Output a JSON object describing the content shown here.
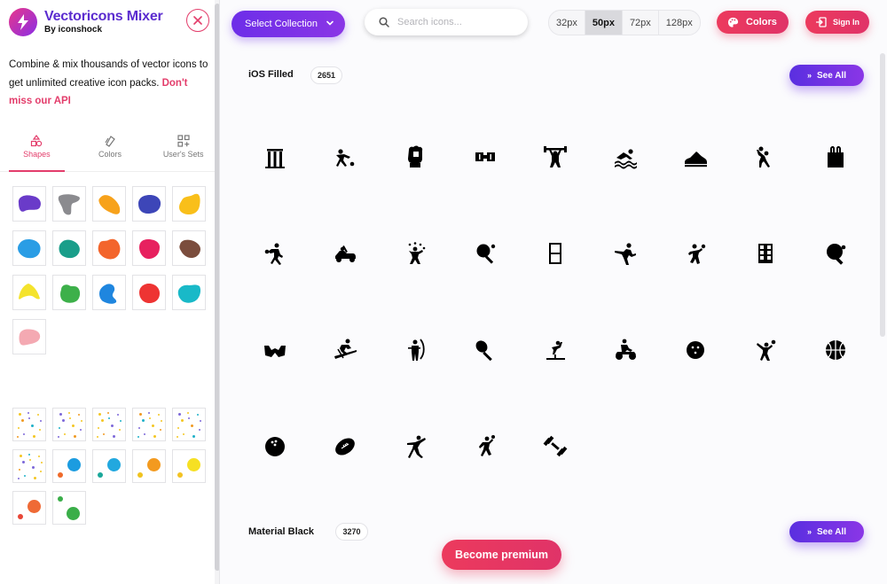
{
  "brand": {
    "title": "Vectoricons Mixer",
    "subtitle": "By iconshock"
  },
  "intro": {
    "text": "Combine & mix thousands of vector icons to get unlimited creative icon packs.",
    "link": "Don't miss our API"
  },
  "side_tabs": [
    {
      "label": "Shapes",
      "icon": "shapes-icon",
      "active": true
    },
    {
      "label": "Colors",
      "icon": "colors-icon",
      "active": false
    },
    {
      "label": "User's Sets",
      "icon": "grid-plus-icon",
      "active": false
    }
  ],
  "shape_colors": [
    "#6a3bc9",
    "#8b8b8f",
    "#f7a21b",
    "#3d46b8",
    "#f9bf1a",
    "#2a9de5",
    "#1a9e8a",
    "#f3652c",
    "#e7215f",
    "#7b4d3d",
    "#f4e32d",
    "#3db04a",
    "#1f86df",
    "#ee3433",
    "#19b9c8",
    "#f4a9b2"
  ],
  "dot_swatches": [
    {
      "kind": "confetti"
    },
    {
      "kind": "confetti"
    },
    {
      "kind": "confetti"
    },
    {
      "kind": "confetti"
    },
    {
      "kind": "confetti"
    },
    {
      "kind": "confetti"
    },
    {
      "kind": "pair",
      "big": "#1c9ce0",
      "small": "#ef6a2a"
    },
    {
      "kind": "pair",
      "big": "#22a8df",
      "small": "#1aa79a"
    },
    {
      "kind": "pair",
      "big": "#f39a1f",
      "small": "#f0c31f"
    },
    {
      "kind": "pair",
      "big": "#f6e023",
      "small": "#f3c323"
    },
    {
      "kind": "pair",
      "big": "#ef6a35",
      "small": "#e84637"
    },
    {
      "kind": "pair",
      "big": "#3aae49",
      "small": "#3aae49"
    }
  ],
  "topbar": {
    "select_collection": "Select Collection",
    "search_placeholder": "Search icons...",
    "sizes": [
      {
        "label": "32px",
        "active": false
      },
      {
        "label": "50px",
        "active": true
      },
      {
        "label": "72px",
        "active": false
      },
      {
        "label": "128px",
        "active": false
      }
    ],
    "colors_label": "Colors",
    "signin_label": "Sign In"
  },
  "sections": [
    {
      "title": "iOS Filled",
      "count": "2651",
      "see_all": "See All"
    },
    {
      "title": "Material Black",
      "count": "3270",
      "see_all": "See All"
    }
  ],
  "icons": [
    "cricket-wicket-icon",
    "bowling-player-icon",
    "boxing-glove-icon",
    "badminton-shuttle-icon",
    "weightlifting-icon",
    "swimming-icon",
    "sneaker-icon",
    "volleyball-player-icon",
    "sports-bag-icon",
    "table-tennis-player-icon",
    "go-kart-icon",
    "juggling-icon",
    "racket-ball-icon",
    "soccer-goal-icon",
    "kickboxing-icon",
    "tennis-player-icon",
    "scoreboard-icon",
    "ping-pong-paddle-icon",
    "boxing-shorts-icon",
    "skiing-icon",
    "archery-icon",
    "tennis-racket-icon",
    "gymnastics-icon",
    "atv-rider-icon",
    "ball-icon",
    "volleyball-spike-icon",
    "basketball-icon",
    "bowling-ball-icon",
    "rugby-ball-icon",
    "dancer-icon",
    "cheerleader-icon",
    "dumbbell-icon"
  ],
  "premium_label": "Become premium"
}
